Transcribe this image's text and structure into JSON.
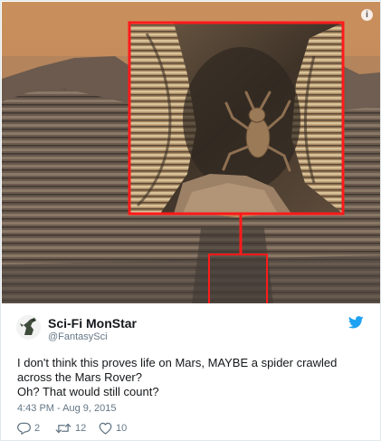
{
  "photo": {
    "alt_icon": "info-icon",
    "highlight_color": "#ff1a1a"
  },
  "tweet": {
    "display_name": "Sci-Fi MonStar",
    "handle": "@FantasySci",
    "text_lines": [
      "I don't think this proves life on Mars, MAYBE a spider crawled",
      "across the Mars Rover?",
      "Oh? That would still count?"
    ],
    "timestamp": "4:43 PM - Aug 9, 2015",
    "actions": {
      "reply_count": "2",
      "retweet_count": "12",
      "like_count": "10"
    },
    "icons": {
      "reply": "reply-icon",
      "retweet": "retweet-icon",
      "like": "heart-icon",
      "brand": "twitter-bird-icon"
    },
    "brand_color": "#1da1f2"
  }
}
